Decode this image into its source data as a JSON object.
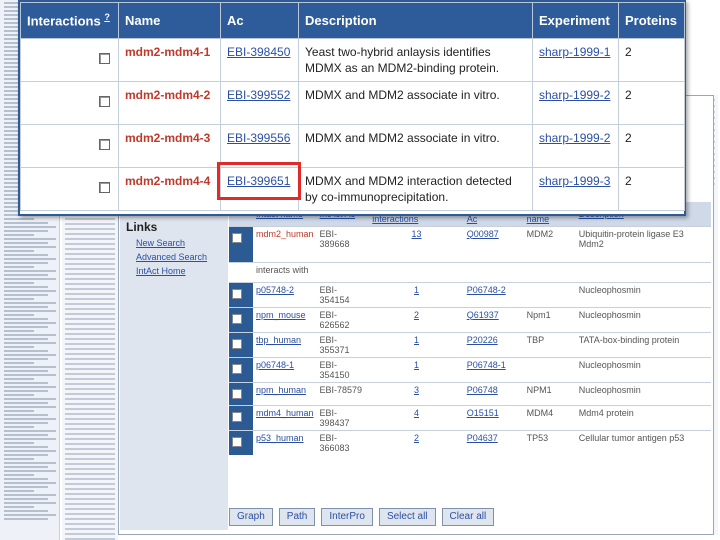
{
  "popup": {
    "headers": {
      "interactions": "Interactions",
      "interactions_sup": "?",
      "name": "Name",
      "ac": "Ac",
      "description": "Description",
      "experiment": "Experiment",
      "proteins": "Proteins"
    },
    "rows": [
      {
        "name": "mdm2-mdm4-1",
        "ac": "EBI-398450",
        "description": "Yeast two-hybrid anlaysis identifies MDMX as an MDM2-binding protein.",
        "experiment": "sharp-1999-1",
        "proteins": "2"
      },
      {
        "name": "mdm2-mdm4-2",
        "ac": "EBI-399552",
        "description": "MDMX and MDM2 associate in vitro.",
        "experiment": "sharp-1999-2",
        "proteins": "2"
      },
      {
        "name": "mdm2-mdm4-3",
        "ac": "EBI-399556",
        "description": "MDMX and MDM2 associate in vitro.",
        "experiment": "sharp-1999-2",
        "proteins": "2"
      },
      {
        "name": "mdm2-mdm4-4",
        "ac": "EBI-399651",
        "description": "MDMX and MDM2 interaction detected by co-immunoprecipitation.",
        "experiment": "sharp-1999-3",
        "proteins": "2"
      }
    ]
  },
  "background": {
    "links_title": "Links",
    "links": [
      "New Search",
      "Advanced Search",
      "IntAct Home"
    ],
    "table_headers": [
      "Intact name",
      "IntAct Ac",
      "Number of interactions",
      "UniProtKB Ac",
      "Gene name",
      "Description"
    ],
    "first_row": {
      "name": "mdm2_human",
      "ac": "EBI-389668",
      "count": "13",
      "uniprot": "Q00987",
      "gene": "MDM2",
      "desc": "Ubiquitin-protein ligase E3 Mdm2"
    },
    "interacts_label": "interacts with",
    "rows": [
      {
        "name": "p05748-2",
        "ac": "EBI-354154",
        "count": "1",
        "uniprot": "P06748-2",
        "gene": "",
        "desc": "Nucleophosmin"
      },
      {
        "name": "npm_mouse",
        "ac": "EBI-626562",
        "count": "2",
        "uniprot": "Q61937",
        "gene": "Npm1",
        "desc": "Nucleophosmin"
      },
      {
        "name": "tbp_human",
        "ac": "EBI-355371",
        "count": "1",
        "uniprot": "P20226",
        "gene": "TBP",
        "desc": "TATA-box-binding protein"
      },
      {
        "name": "p06748-1",
        "ac": "EBI-354150",
        "count": "1",
        "uniprot": "P06748-1",
        "gene": "",
        "desc": "Nucleophosmin"
      },
      {
        "name": "npm_human",
        "ac": "EBI-78579",
        "count": "3",
        "uniprot": "P06748",
        "gene": "NPM1",
        "desc": "Nucleophosmin"
      },
      {
        "name": "mdm4_human",
        "ac": "EBI-398437",
        "count": "4",
        "uniprot": "O15151",
        "gene": "MDM4",
        "desc": "Mdm4 protein"
      },
      {
        "name": "p53_human",
        "ac": "EBI-366083",
        "count": "2",
        "uniprot": "P04637",
        "gene": "TP53",
        "desc": "Cellular tumor antigen p53"
      }
    ],
    "buttons": [
      "Graph",
      "Path",
      "InterPro",
      "Select all",
      "Clear all"
    ]
  },
  "colors": {
    "header_bg": "#2e5c9a",
    "name_red": "#c0392b",
    "link_blue": "#2a4fa5",
    "highlight": "#e02b2b"
  }
}
